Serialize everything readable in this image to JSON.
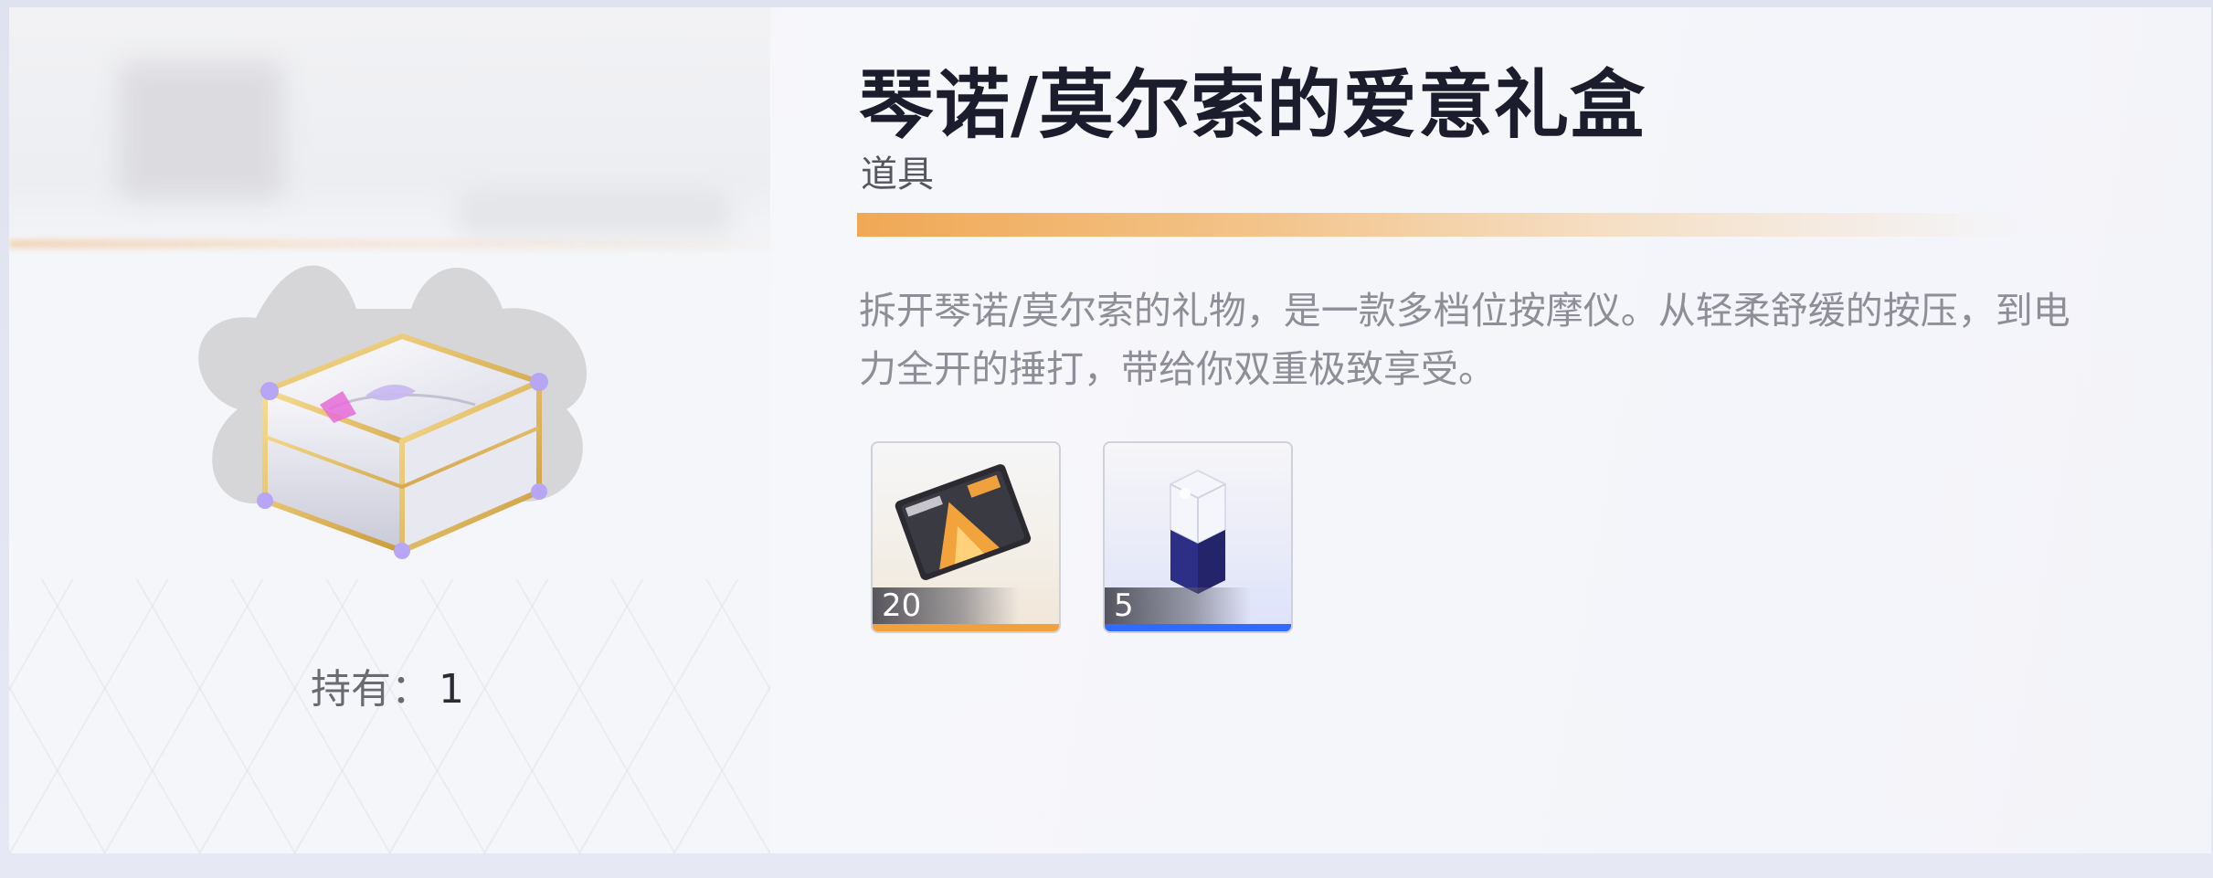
{
  "item": {
    "name": "琴诺/莫尔索的爱意礼盒",
    "category": "道具",
    "rarity_color": "#f0a854",
    "description": "拆开琴诺/莫尔索的礼物，是一款多档位按摩仪。从轻柔舒缓的按压，到电力全开的捶打，带给你双重极致享受。",
    "owned_label": "持有：",
    "owned_value": "1"
  },
  "rewards": [
    {
      "icon": "ticket-card-icon",
      "quantity": "20",
      "rarity_color": "#f0a03c"
    },
    {
      "icon": "crystal-bottle-icon",
      "quantity": "5",
      "rarity_color": "#2f6bff"
    }
  ]
}
